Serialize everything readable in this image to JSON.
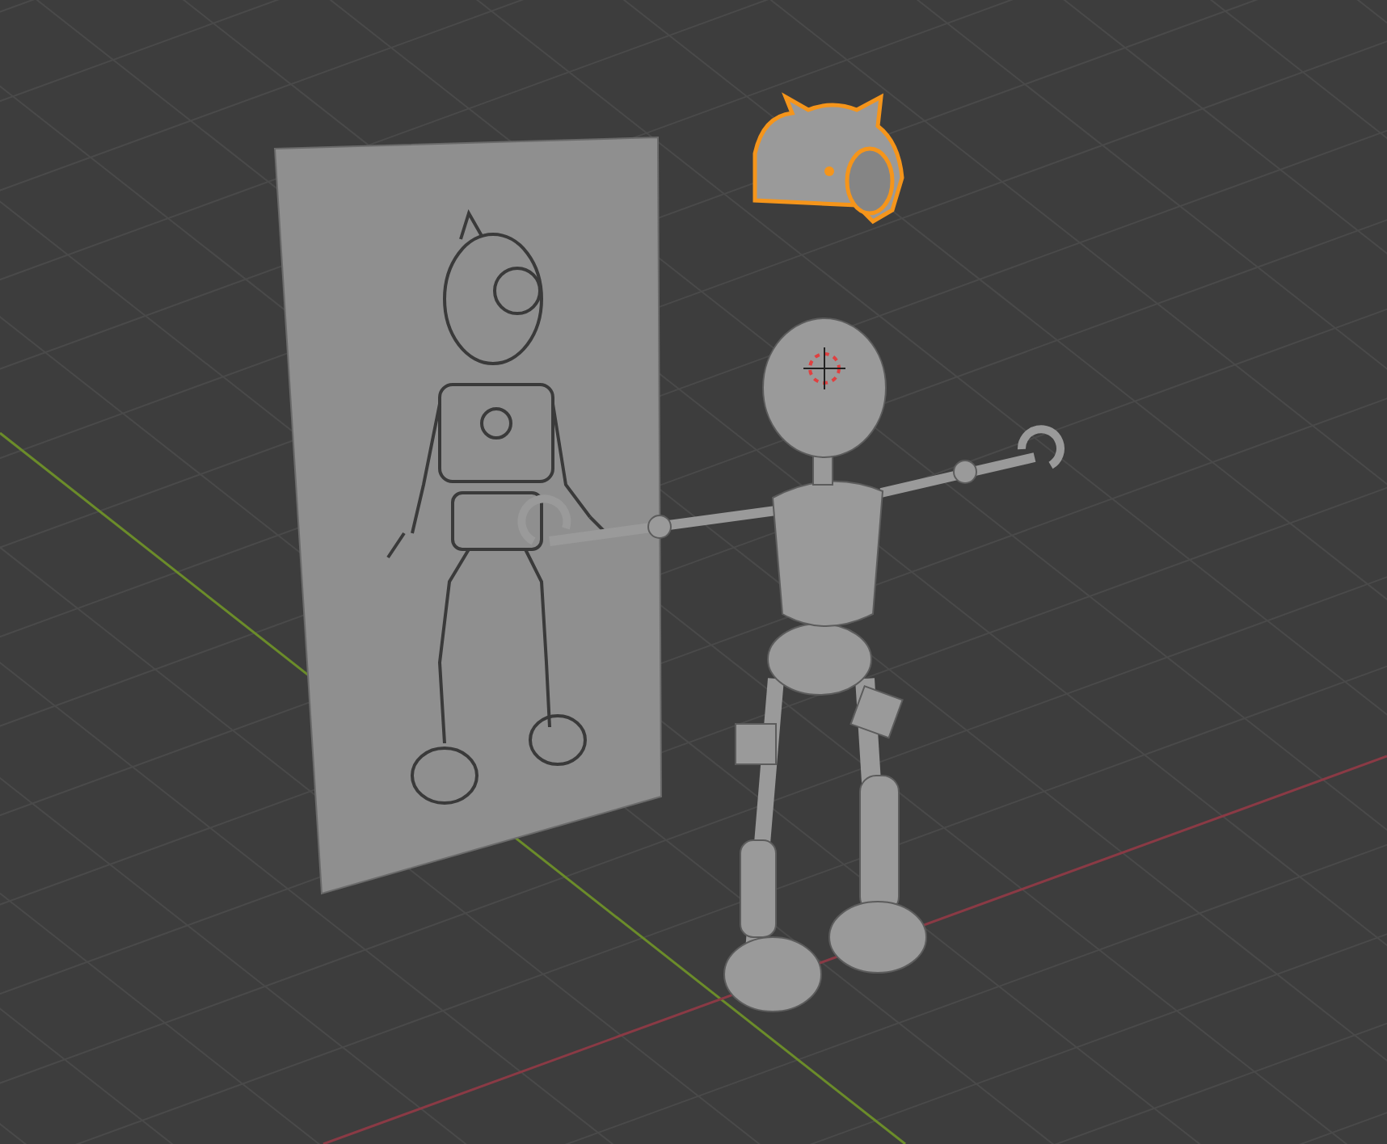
{
  "objects": [
    {
      "kind": "reference_image",
      "selected": false
    },
    {
      "kind": "robot",
      "selected": false
    },
    {
      "kind": "helmet",
      "selected": true
    }
  ]
}
